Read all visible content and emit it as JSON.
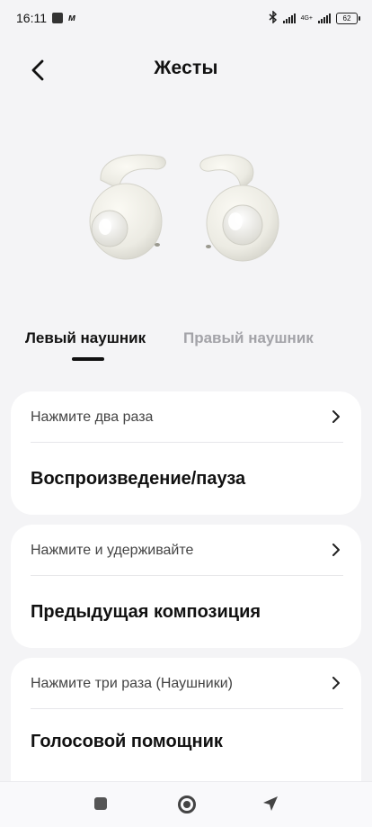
{
  "status_bar": {
    "time": "16:11",
    "network": "4G+",
    "battery": "62"
  },
  "header": {
    "title": "Жесты"
  },
  "tabs": [
    {
      "label": "Левый наушник",
      "active": true
    },
    {
      "label": "Правый наушник",
      "active": false
    }
  ],
  "gestures": [
    {
      "action": "Нажмите два раза",
      "value": "Воспроизведение/пауза"
    },
    {
      "action": "Нажмите и удерживайте",
      "value": "Предыдущая композиция"
    },
    {
      "action": "Нажмите три раза (Наушники)",
      "value": "Голосовой помощник"
    }
  ],
  "icons": {
    "back": "chevron-left-icon",
    "row_arrow": "chevron-right-icon",
    "nav": [
      "recents-square-icon",
      "home-circle-icon",
      "back-triangle-icon"
    ]
  },
  "colors": {
    "background": "#f4f4f6",
    "card": "#ffffff",
    "active_tab": "#111111",
    "inactive_tab": "#a3a3a8"
  }
}
